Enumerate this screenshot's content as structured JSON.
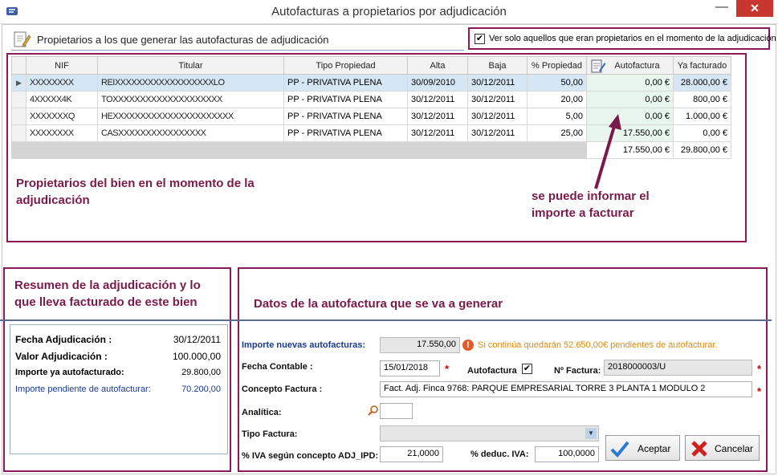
{
  "window": {
    "title": "Autofacturas a propietarios por adjudicación",
    "close": "✕",
    "minimize": "—"
  },
  "header": {
    "label": "Propietarios a los que generar las autofacturas de adjudicación",
    "checkbox_label": "Ver solo aquellos que eran propietarios en el momento de la adjudicación",
    "checkbox_checked": true
  },
  "grid": {
    "columns": [
      "NIF",
      "Titular",
      "Tipo Propiedad",
      "Alta",
      "Baja",
      "% Propiedad",
      "Autofactura",
      "Ya facturado"
    ],
    "rows": [
      {
        "nif": "XXXXXXXX",
        "titular": "REIXXXXXXXXXXXXXXXXXXLO",
        "tipo": "PP - PRIVATIVA PLENA",
        "alta": "30/09/2010",
        "baja": "30/12/2011",
        "pct": "50,00",
        "autof": "0,00 €",
        "ya": "28.000,00 €"
      },
      {
        "nif": "4XXXXX4K",
        "titular": "TOXXXXXXXXXXXXXXXXXXXX",
        "tipo": "PP - PRIVATIVA PLENA",
        "alta": "30/12/2011",
        "baja": "30/12/2011",
        "pct": "20,00",
        "autof": "0,00 €",
        "ya": "800,00 €"
      },
      {
        "nif": "XXXXXXXQ",
        "titular": "HEXXXXXXXXXXXXXXXXXXXXXX",
        "tipo": "PP - PRIVATIVA PLENA",
        "alta": "30/12/2011",
        "baja": "30/12/2011",
        "pct": "5,00",
        "autof": "0,00 €",
        "ya": "1.000,00 €"
      },
      {
        "nif": "XXXXXXXX",
        "titular": "CASXXXXXXXXXXXXXXXX",
        "tipo": "PP - PRIVATIVA PLENA",
        "alta": "30/12/2011",
        "baja": "30/12/2011",
        "pct": "25,00",
        "autof": "17.550,00 €",
        "ya": "0,00 €"
      }
    ],
    "totals": {
      "autof": "17.550,00 €",
      "ya": "29.800,00 €"
    }
  },
  "annotations": {
    "owners": "Propietarios del bien en el momento de la adjudicación",
    "importe": "se puede informar el importe a facturar",
    "resumen": "Resumen de la adjudicación y lo que lleva facturado de este bien",
    "datos": "Datos de la autofactura que se va a generar"
  },
  "resumen": {
    "fecha_label": "Fecha Adjudicación :",
    "fecha": "30/12/2011",
    "valor_label": "Valor Adjudicación :",
    "valor": "100.000,00",
    "ya_label": "Importe ya autofacturado:",
    "ya": "29.800,00",
    "pend_label": "Importe pendiente de autofacturar:",
    "pend": "70.200,00"
  },
  "form": {
    "importe_label": "Importe nuevas autofacturas:",
    "importe": "17.550,00",
    "warning": "Si continúa quedarán 52.650,00€ pendientes de autofacturar.",
    "fecha_label": "Fecha Contable :",
    "fecha": "15/01/2018",
    "autofactura_label": "Autofactura",
    "autofactura_checked": true,
    "nfactura_label": "Nº Factura:",
    "nfactura": "2018000003/U",
    "concepto_label": "Concepto Factura :",
    "concepto": "Fact. Adj. Finca 9768: PARQUE EMPRESARIAL TORRE 3 PLANTA 1 MODULO 2",
    "analitica_label": "Analítica:",
    "analitica": "",
    "tipo_label": "Tipo Factura:",
    "tipo": "",
    "iva_label": "% IVA según concepto ADJ_IPD:",
    "iva": "21,0000",
    "deduc_label": "% deduc. IVA:",
    "deduc": "100,0000",
    "req": "*"
  },
  "buttons": {
    "aceptar": "Aceptar",
    "cancelar": "Cancelar"
  },
  "colors": {
    "annotation": "#7a1a4a",
    "frame": "#8b1a5a",
    "warning": "#e08a10",
    "selected_row": "#d5e6f5"
  }
}
